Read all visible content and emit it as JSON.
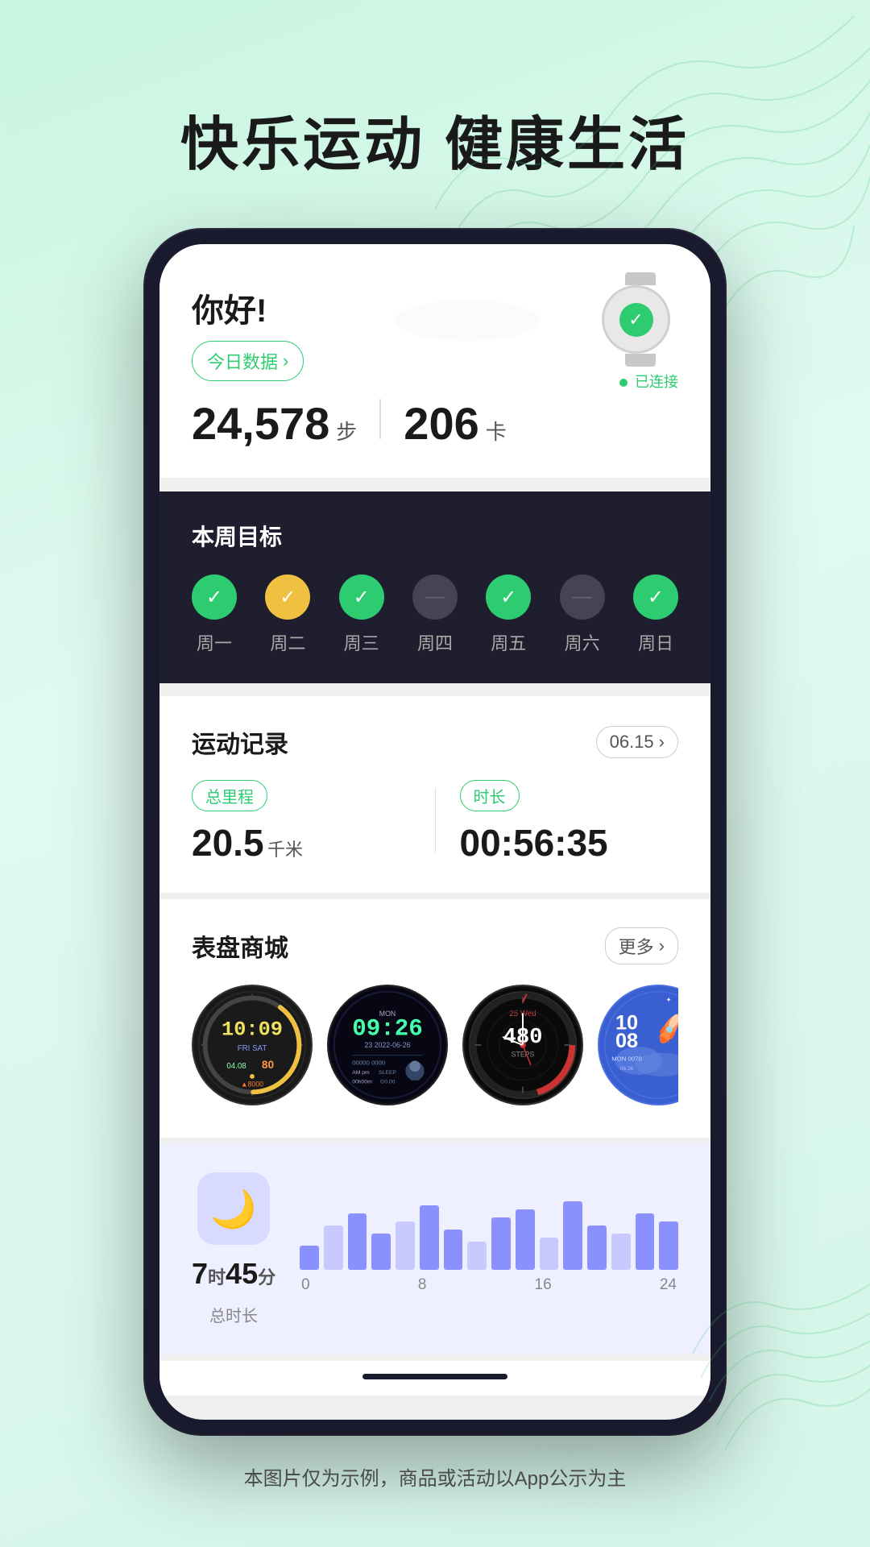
{
  "page": {
    "background_headline": "快乐运动 健康生活",
    "footer_text": "本图片仅为示例，商品或活动以App公示为主"
  },
  "header": {
    "greeting": "你好!",
    "today_btn_label": "今日数据",
    "steps_value": "24,578",
    "steps_unit": "步",
    "calories_value": "206",
    "calories_unit": "卡",
    "connected_text": "已连接"
  },
  "weekly_goals": {
    "title": "本周目标",
    "days": [
      {
        "label": "周一",
        "status": "green"
      },
      {
        "label": "周二",
        "status": "yellow"
      },
      {
        "label": "周三",
        "status": "green"
      },
      {
        "label": "周四",
        "status": "gray"
      },
      {
        "label": "周五",
        "status": "green"
      },
      {
        "label": "周六",
        "status": "gray"
      },
      {
        "label": "周日",
        "status": "green"
      }
    ]
  },
  "exercise_record": {
    "title": "运动记录",
    "date": "06.15",
    "distance_label": "总里程",
    "distance_value": "20.5",
    "distance_unit": "千米",
    "duration_label": "时长",
    "duration_value": "00:56:35"
  },
  "watch_store": {
    "title": "表盘商城",
    "more_label": "更多",
    "faces": [
      {
        "id": "face1",
        "time": "10:09",
        "date": "FRI SAT",
        "steps": "04.08",
        "extra": "80"
      },
      {
        "id": "face2",
        "time": "09:26",
        "date": "23 2022-06-26",
        "mon": "MON"
      },
      {
        "id": "face3",
        "time": "25 Wed",
        "sub": "480"
      },
      {
        "id": "face4",
        "time": "10 08",
        "label": "Mon 0070",
        "date": "06.26"
      }
    ]
  },
  "sleep": {
    "icon": "🌙",
    "hours": "7",
    "hours_unit": "时",
    "minutes": "45",
    "minutes_unit": "分",
    "total_label": "总时长",
    "axis_labels": [
      "0",
      "8",
      "16",
      "24"
    ],
    "bars": [
      30,
      55,
      70,
      45,
      60,
      80,
      50,
      35,
      65,
      75,
      40,
      85,
      55,
      45,
      70,
      60
    ]
  },
  "icons": {
    "checkmark": "✓",
    "minus": "—",
    "arrow_right": "›"
  }
}
